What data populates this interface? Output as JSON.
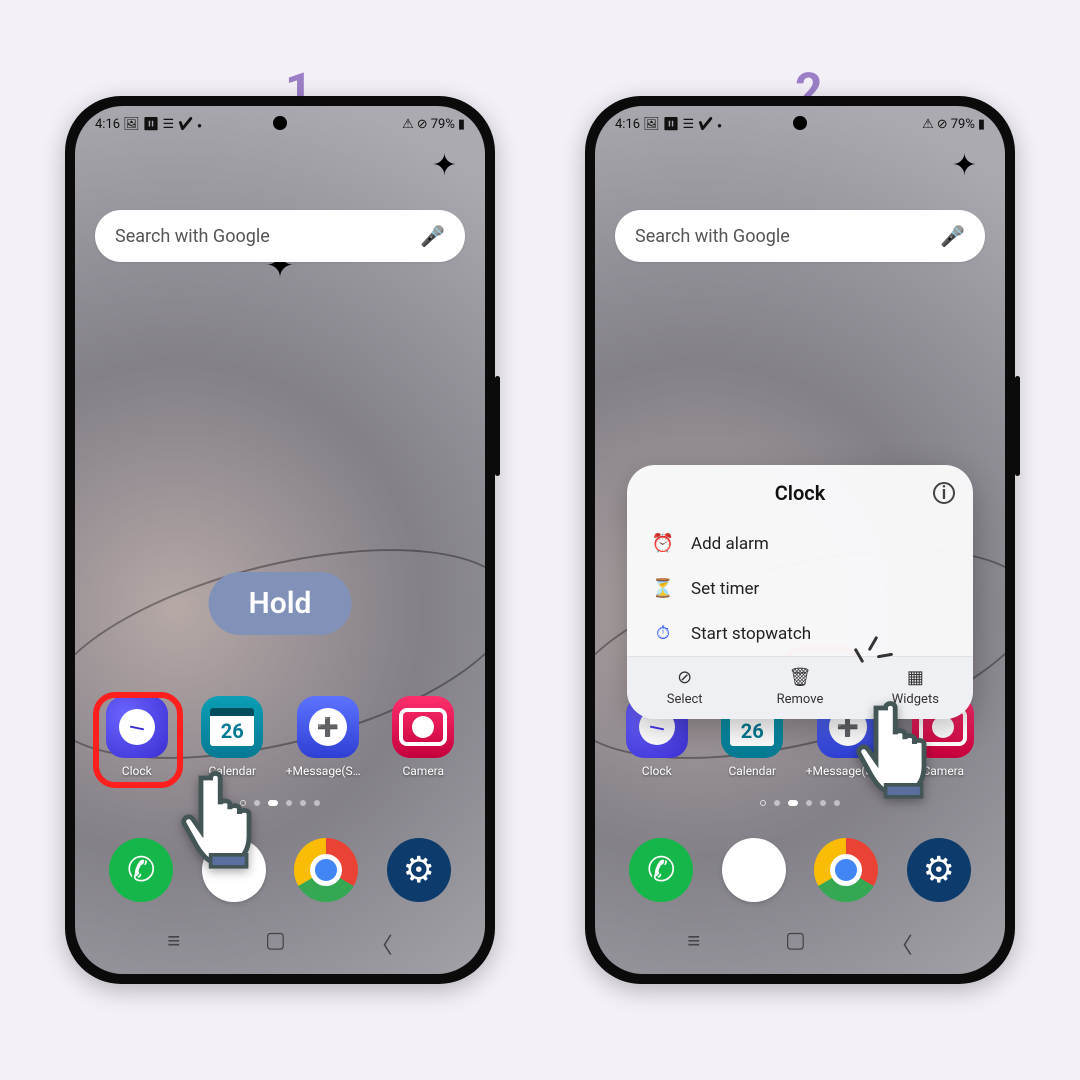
{
  "steps": {
    "one": "1",
    "two": "2"
  },
  "status": {
    "time": "4:16",
    "battery": "79%"
  },
  "search": {
    "placeholder": "Search with Google"
  },
  "hold_badge": "Hold",
  "apps": {
    "clock": {
      "label": "Clock",
      "cal_day": "26"
    },
    "calendar": {
      "label": "Calendar",
      "day": "26"
    },
    "message": {
      "label": "+Message(SM…"
    },
    "camera": {
      "label": "Camera"
    }
  },
  "ctx": {
    "title": "Clock",
    "items": {
      "alarm": "Add alarm",
      "timer": "Set timer",
      "stopwatch": "Start stopwatch"
    },
    "actions": {
      "select": "Select",
      "remove": "Remove",
      "widgets": "Widgets"
    }
  }
}
